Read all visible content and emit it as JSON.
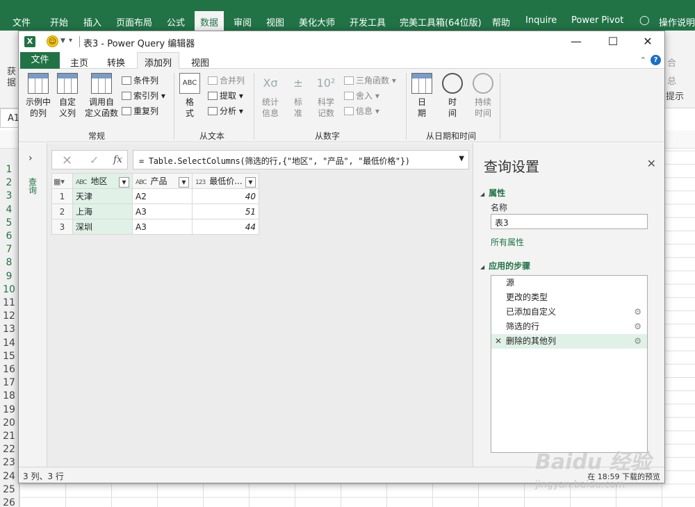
{
  "excel": {
    "tabs": [
      "文件",
      "开始",
      "插入",
      "页面布局",
      "公式",
      "数据",
      "审阅",
      "视图",
      "美化大师",
      "开发工具",
      "完美工具箱(64位版)",
      "帮助",
      "Inquire",
      "Power Pivot",
      "操作说明"
    ],
    "active_tab": "数据",
    "namebox": "A1",
    "row_numbers": [
      "1",
      "2",
      "3",
      "4",
      "5",
      "6",
      "7",
      "8",
      "9",
      "10",
      "11",
      "12",
      "13",
      "14",
      "15",
      "16",
      "17",
      "18",
      "19",
      "20",
      "21",
      "22",
      "23",
      "24",
      "25",
      "26"
    ],
    "frag_left1": "获",
    "frag_left2": "据",
    "frag_right1": "合",
    "frag_right2": "总",
    "frag_right3": "提示"
  },
  "pq": {
    "title": "表3 - Power Query 编辑器",
    "tabs": {
      "file": "文件",
      "home": "主页",
      "transform": "转换",
      "add_column": "添加列",
      "view": "视图"
    },
    "ribbon": {
      "group_general": "常规",
      "btn_example": "示例中\n的列",
      "btn_custom": "自定\n义列",
      "btn_invoke": "调用自\n定义函数",
      "btn_conditional": "条件列",
      "btn_index": "索引列",
      "btn_duplicate": "重复列",
      "group_text": "从文本",
      "btn_format": "格\n式",
      "btn_merge": "合并列",
      "btn_extract": "提取",
      "btn_parse": "分析",
      "group_number": "从数字",
      "btn_stats": "统计\n信息",
      "btn_standard": "标\n准",
      "btn_scientific": "科学\n记数",
      "btn_trig": "三角函数",
      "btn_rounding": "舍入",
      "btn_info": "信息",
      "group_datetime": "从日期和时间",
      "btn_date": "日\n期",
      "btn_time": "时\n间",
      "btn_duration": "持续\n时间"
    },
    "side_label": "查询",
    "formula": "= Table.SelectColumns(筛选的行,{\"地区\", \"产品\", \"最低价格\"})",
    "columns": [
      {
        "type": "ABC",
        "name": "地区"
      },
      {
        "type": "ABC",
        "name": "产品"
      },
      {
        "type": "123",
        "name": "最低价..."
      }
    ],
    "rows": [
      {
        "n": "1",
        "region": "天津",
        "product": "A2",
        "price": "40"
      },
      {
        "n": "2",
        "region": "上海",
        "product": "A3",
        "price": "51"
      },
      {
        "n": "3",
        "region": "深圳",
        "product": "A3",
        "price": "44"
      }
    ],
    "settings": {
      "title": "查询设置",
      "props_header": "属性",
      "name_label": "名称",
      "name_value": "表3",
      "all_props": "所有属性",
      "steps_header": "应用的步骤",
      "steps": [
        "源",
        "更改的类型",
        "已添加自定义",
        "筛选的行",
        "删除的其他列"
      ]
    },
    "status_left": "3 列、3 行",
    "status_right": "在 18:59 下载的预览"
  },
  "watermark": "Baidu 经验",
  "watermark_url": "jingyan.baidu.com"
}
